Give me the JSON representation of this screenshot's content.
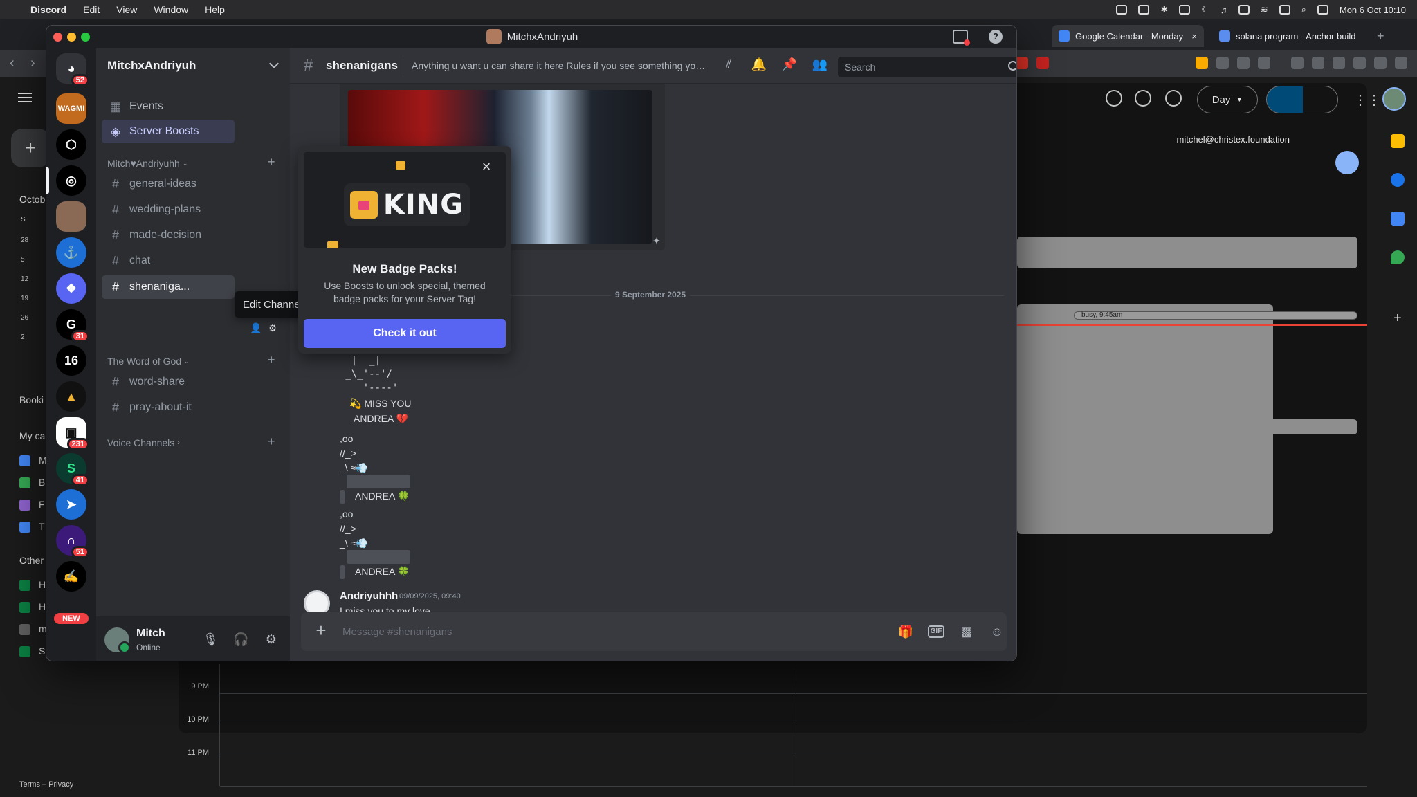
{
  "menubar": {
    "app": "Discord",
    "items": [
      "Edit",
      "View",
      "Window",
      "Help"
    ],
    "clock": "Mon 6 Oct  10:10"
  },
  "browser": {
    "tabs": [
      {
        "label": "Google Calendar - Monday",
        "close": "×"
      },
      {
        "label": "solana program - Anchor build"
      }
    ],
    "new_tab": "+"
  },
  "gcal": {
    "view_select": "Day",
    "email": "mitchel@christex.foundation",
    "busy_event": "busy, 9:45am",
    "times": [
      "9 PM",
      "10 PM",
      "11 PM"
    ],
    "left_labels": [
      "Octob",
      "Booki",
      "My ca",
      "Other"
    ],
    "mini_cal": [
      "S",
      "28",
      "5",
      "12",
      "19",
      "26",
      "2"
    ],
    "calendar_rows": [
      "M",
      "B",
      "F",
      "T",
      "H",
      "H",
      "m",
      "S"
    ],
    "footer": "Terms – Privacy",
    "create": "+"
  },
  "discord": {
    "window_title": "MitchxAndriyuh",
    "help": "?",
    "server_name": "MitchxAndriyuh",
    "rail": {
      "home_badge": "52",
      "badges": {
        "s7": "31",
        "s10": "231",
        "s11": "41",
        "s13": "51"
      },
      "new_label": "NEW",
      "wagmi": "WAGMI",
      "num16": "16"
    },
    "sidebar": {
      "events": "Events",
      "boosts": "Server Boosts",
      "cat1": "Mitch♥Andriyuhh",
      "channels1": [
        "general-ideas",
        "wedding-plans",
        "made-decision",
        "chat",
        "shenaniga..."
      ],
      "cat2": "The Word of God",
      "channels2": [
        "word-share",
        "pray-about-it"
      ],
      "cat3": "Voice Channels"
    },
    "tooltip": "Edit Channel",
    "user": {
      "name": "Mitch",
      "status": "Online"
    },
    "channel": {
      "name": "shenanigans",
      "topic": "Anything u want u can share it here Rules if you see something you like, share it",
      "search_placeholder": "Search"
    },
    "date_divider": "9 September 2025",
    "ascii_lines": [
      "  |  _|",
      " _\\_'--'/",
      "    '----'"
    ],
    "msg_lines": [
      "💫 MISS YOU",
      "ANDREA 💔",
      ",oo",
      " //_>",
      " _\\  ≈💨",
      "ANDREA 🍀",
      ",oo",
      " //_>",
      " _\\  ≈💨",
      "ANDREA 🍀"
    ],
    "message": {
      "author": "Andriyuhhh",
      "timestamp": "09/09/2025, 09:40",
      "text": "I miss you to my love"
    },
    "composer_placeholder": "Message #shenanigans",
    "popup": {
      "king": "KING",
      "title": "New Badge Packs!",
      "desc": "Use Boosts to unlock special, themed badge packs for your Server Tag!",
      "button": "Check it out",
      "close": "×"
    }
  },
  "colors": {
    "blurple": "#5865f2",
    "red": "#f23f43",
    "green": "#23a55a"
  }
}
